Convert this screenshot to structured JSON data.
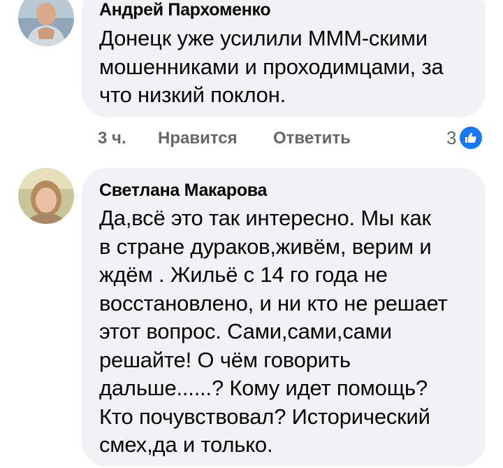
{
  "comments": [
    {
      "author": "Андрей Пархоменко",
      "lines": [
        "Донецк уже усилили МММ-скими",
        "мошенниками и проходимцами, за",
        "что низкий поклон."
      ],
      "time": "3 ч.",
      "like_label": "Нравится",
      "reply_label": "Ответить",
      "reaction_count": "3",
      "reaction_icon": "thumbs-up-icon",
      "reaction_color": "#1877f2"
    },
    {
      "author": "Светлана Макарова",
      "lines": [
        "Да,всё  это так интересно. Мы как",
        "в стране дураков,живём, верим и",
        "ждём . Жильё  с 14 го года не",
        "восстановлено, и ни кто не решает",
        "этот вопрос. Сами,сами,сами",
        "решайте! О чём  говорить",
        "дальше......? Кому идет помощь?",
        "Кто почувствовал? Исторический",
        "смех,да и только."
      ]
    }
  ],
  "colors": {
    "bubble": "#f0f2f5",
    "meta_text": "#65676b"
  }
}
